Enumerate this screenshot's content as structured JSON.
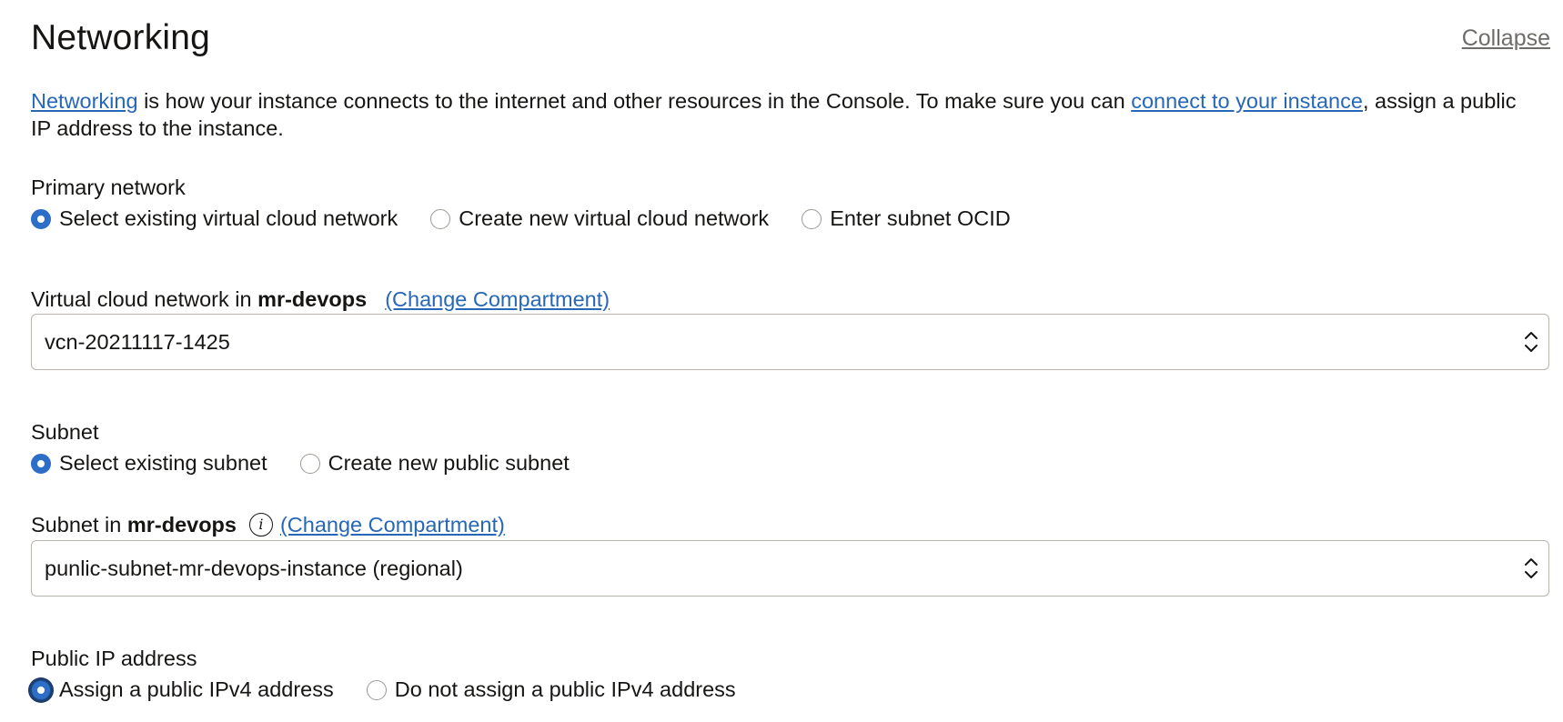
{
  "section": {
    "title": "Networking",
    "collapse_label": "Collapse"
  },
  "intro": {
    "link1": "Networking",
    "text1": " is how your instance connects to the internet and other resources in the Console. To make sure you can ",
    "link2": "connect to your instance",
    "text2": ", assign a public IP address to the instance."
  },
  "primary_network": {
    "label": "Primary network",
    "options": [
      {
        "label": "Select existing virtual cloud network",
        "selected": true
      },
      {
        "label": "Create new virtual cloud network",
        "selected": false
      },
      {
        "label": "Enter subnet OCID",
        "selected": false
      }
    ]
  },
  "vcn": {
    "label_prefix": "Virtual cloud network in ",
    "compartment": "mr-devops",
    "change_link": "(Change Compartment)",
    "value": "vcn-20211117-1425"
  },
  "subnet_choice": {
    "label": "Subnet",
    "options": [
      {
        "label": "Select existing subnet",
        "selected": true
      },
      {
        "label": "Create new public subnet",
        "selected": false
      }
    ]
  },
  "subnet": {
    "label_prefix": "Subnet in ",
    "compartment": "mr-devops",
    "info_glyph": "i",
    "change_link": "(Change Compartment)",
    "value": "punlic-subnet-mr-devops-instance (regional)"
  },
  "public_ip": {
    "label": "Public IP address",
    "options": [
      {
        "label": "Assign a public IPv4 address",
        "selected": true
      },
      {
        "label": "Do not assign a public IPv4 address",
        "selected": false
      }
    ]
  },
  "colors": {
    "link": "#2767b8",
    "radio_selected": "#2c6ec8",
    "text": "#161513",
    "border": "#b8b3ad"
  },
  "icons": {
    "select_arrows": "chevron-up-down-icon",
    "info": "info-icon"
  }
}
